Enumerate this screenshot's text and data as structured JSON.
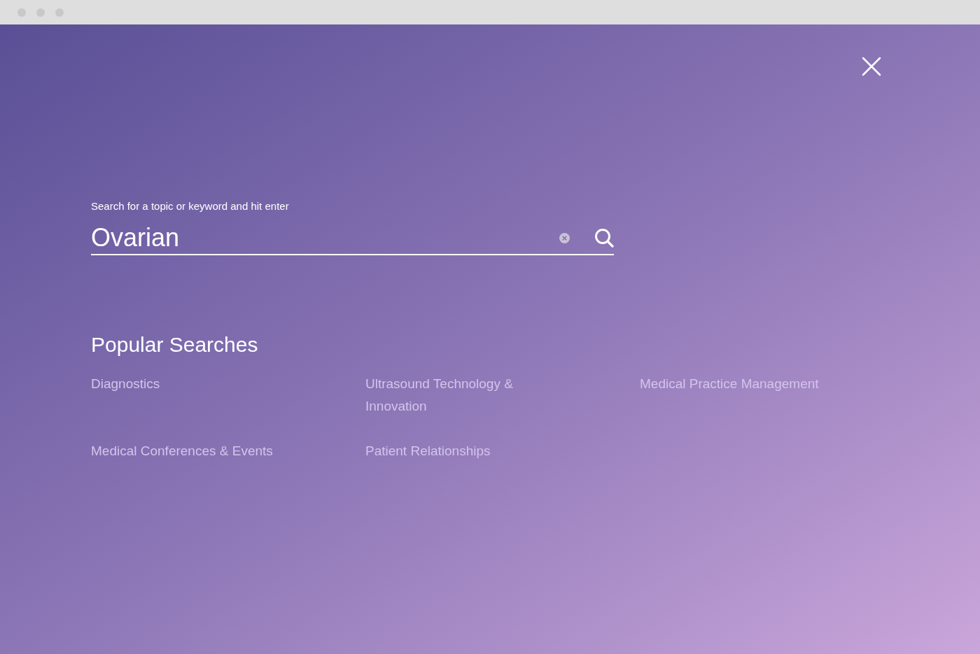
{
  "search": {
    "label": "Search for a topic or keyword and hit enter",
    "value": "Ovarian"
  },
  "popular": {
    "title": "Popular Searches",
    "items": [
      "Diagnostics",
      "Ultrasound Technology & Innovation",
      "Medical Practice Management",
      "Medical Conferences & Events",
      "Patient Relationships"
    ]
  }
}
